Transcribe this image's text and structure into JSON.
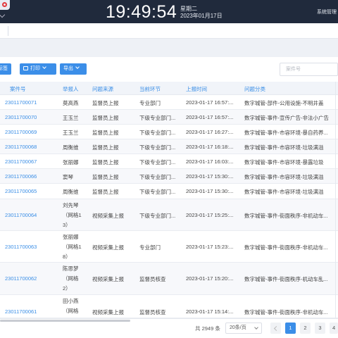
{
  "header": {
    "time": "19:49:54",
    "weekday": "星期二",
    "date": "2023年01月17日",
    "user_menu": "系统管理"
  },
  "toolbar": {
    "label_button": "标签",
    "print_button": "打印",
    "export_button": "导出",
    "search_placeholder": "案件号"
  },
  "table": {
    "columns": [
      "案件号",
      "举报人",
      "问题来源",
      "当前环节",
      "上报时间",
      "问题分类"
    ],
    "rows": [
      {
        "id": "23011700071",
        "reporter": "莫高燕",
        "source": "监督员上报",
        "stage": "专业部门",
        "time": "2023-01-17 16:57:...",
        "category": "数字城管-部件-公用设施-不明井盖"
      },
      {
        "id": "23011700070",
        "reporter": "王玉兰",
        "source": "监督员上报",
        "stage": "下级专业部门...",
        "time": "2023-01-17 16:57:...",
        "category": "数字城管-事件-宣传广告-非法小广告"
      },
      {
        "id": "23011700069",
        "reporter": "王玉兰",
        "source": "监督员上报",
        "stage": "下级专业部门...",
        "time": "2023-01-17 16:27:...",
        "category": "数字城管-事件-市容环境-暴自药养..."
      },
      {
        "id": "23011700068",
        "reporter": "周衡维",
        "source": "监督员上报",
        "stage": "下级专业部门...",
        "time": "2023-01-17 16:18:...",
        "category": "数字城管-事件-市容环境-垃圾满溢"
      },
      {
        "id": "23011700067",
        "reporter": "张丽娜",
        "source": "监督员上报",
        "stage": "下级专业部门...",
        "time": "2023-01-17 16:03:...",
        "category": "数字城管-事件-市容环境-暴露垃圾"
      },
      {
        "id": "23011700066",
        "reporter": "窦琴",
        "source": "监督员上报",
        "stage": "下级专业部门...",
        "time": "2023-01-17 15:30:...",
        "category": "数字城管-事件-市容环境-垃圾满溢"
      },
      {
        "id": "23011700065",
        "reporter": "周衡维",
        "source": "监督员上报",
        "stage": "下级专业部门...",
        "time": "2023-01-17 15:30:...",
        "category": "数字城管-事件-市容环境-垃圾满溢"
      },
      {
        "id": "23011700064",
        "reporter": "刘先琴\n（网格1\n3）",
        "source": "视频采集上报",
        "stage": "下级专业部门...",
        "time": "2023-01-17 15:25:...",
        "category": "数字城管-事件-街面秩序-非机动车..."
      },
      {
        "id": "23011700063",
        "reporter": "张丽娜\n（网格1\n8）",
        "source": "视频采集上报",
        "stage": "专业部门",
        "time": "2023-01-17 15:23:...",
        "category": "数字城管-事件-街面秩序-非机动车..."
      },
      {
        "id": "23011700062",
        "reporter": "陈思梦\n（网格\n2）",
        "source": "视频采集上报",
        "stage": "监督员核查",
        "time": "2023-01-17 15:20:...",
        "category": "数字城管-事件-街面秩序-机动车乱..."
      },
      {
        "id": "23011700061",
        "reporter": "田小燕\n（网格",
        "source": "视频采集上报",
        "stage": "监督员核查",
        "time": "2023-01-17 15:14:...",
        "category": "数字城管-事件-街面秩序-非机动车..."
      }
    ]
  },
  "pager": {
    "total": "共 2949 条",
    "page_size": "20条/页",
    "pages": [
      "1",
      "2",
      "3",
      "4"
    ],
    "current_page": "1"
  }
}
